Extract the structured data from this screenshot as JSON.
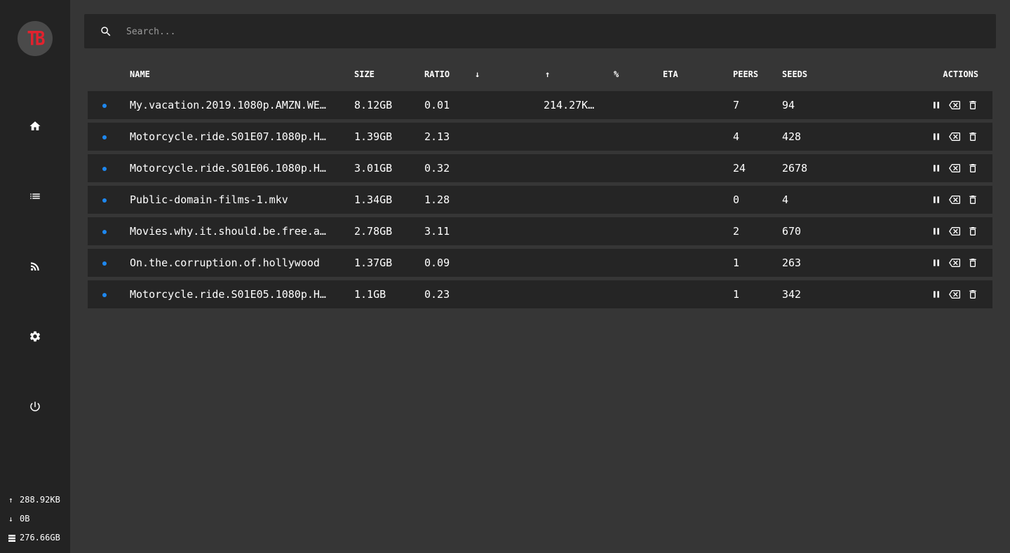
{
  "sidebar": {
    "logo_text": "TB",
    "nav": [
      {
        "icon": "home-icon"
      },
      {
        "icon": "list-icon"
      },
      {
        "icon": "rss-icon"
      },
      {
        "icon": "gear-icon"
      },
      {
        "icon": "power-icon"
      }
    ],
    "stats": {
      "upload": "288.92KB",
      "download": "0B",
      "disk": "276.66GB"
    }
  },
  "search": {
    "placeholder": "Search..."
  },
  "table": {
    "columns": {
      "name": "NAME",
      "size": "SIZE",
      "ratio": "RATIO",
      "down": "↓",
      "up": "↑",
      "percent": "%",
      "eta": "ETA",
      "peers": "PEERS",
      "seeds": "SEEDS",
      "actions": "ACTIONS"
    },
    "rows": [
      {
        "name": "My.vacation.2019.1080p.AMZN.WE…",
        "size": "8.12GB",
        "ratio": "0.01",
        "down": "",
        "up": "214.27K…",
        "percent": "",
        "eta": "",
        "peers": "7",
        "seeds": "94"
      },
      {
        "name": "Motorcycle.ride.S01E07.1080p.H…",
        "size": "1.39GB",
        "ratio": "2.13",
        "down": "",
        "up": "",
        "percent": "",
        "eta": "",
        "peers": "4",
        "seeds": "428"
      },
      {
        "name": "Motorcycle.ride.S01E06.1080p.H…",
        "size": "3.01GB",
        "ratio": "0.32",
        "down": "",
        "up": "",
        "percent": "",
        "eta": "",
        "peers": "24",
        "seeds": "2678"
      },
      {
        "name": "Public-domain-films-1.mkv",
        "size": "1.34GB",
        "ratio": "1.28",
        "down": "",
        "up": "",
        "percent": "",
        "eta": "",
        "peers": "0",
        "seeds": "4"
      },
      {
        "name": "Movies.why.it.should.be.free.a…",
        "size": "2.78GB",
        "ratio": "3.11",
        "down": "",
        "up": "",
        "percent": "",
        "eta": "",
        "peers": "2",
        "seeds": "670"
      },
      {
        "name": "On.the.corruption.of.hollywood",
        "size": "1.37GB",
        "ratio": "0.09",
        "down": "",
        "up": "",
        "percent": "",
        "eta": "",
        "peers": "1",
        "seeds": "263"
      },
      {
        "name": "Motorcycle.ride.S01E05.1080p.H…",
        "size": "1.1GB",
        "ratio": "0.23",
        "down": "",
        "up": "",
        "percent": "",
        "eta": "",
        "peers": "1",
        "seeds": "342"
      }
    ],
    "row_actions": [
      "pause-icon",
      "remove-icon",
      "trash-icon"
    ]
  },
  "colors": {
    "background": "#363636",
    "sidebar": "#232323",
    "row": "#252525",
    "status_dot": "#1e88f0",
    "logo_text": "#e3222e"
  }
}
